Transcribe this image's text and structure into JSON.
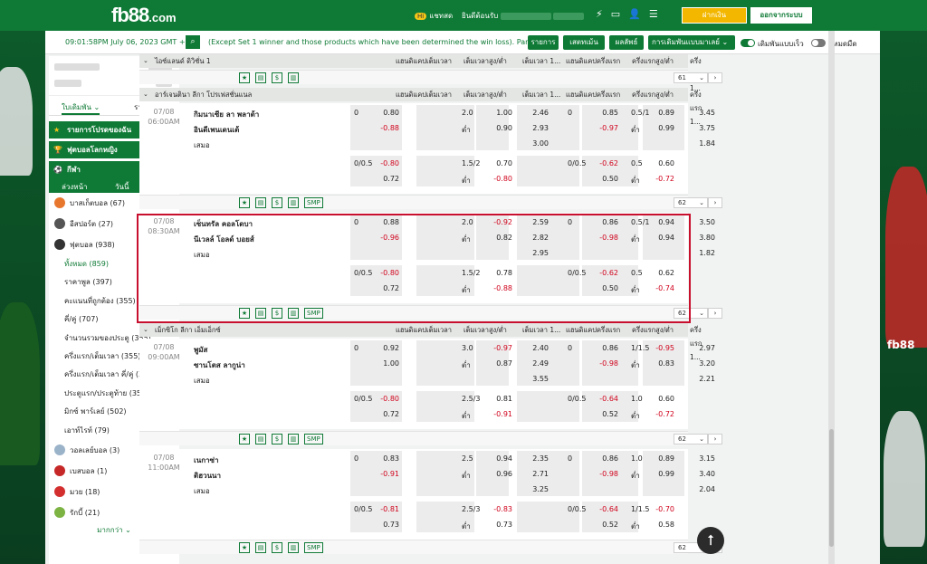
{
  "header": {
    "logo": "fb88",
    "logo_suffix": ".com",
    "chat_badge": "Hi",
    "chat": "แชทสด",
    "welcome": "ยินดีต้อนรับ",
    "deposit": "ฝากเงิน",
    "logout": "ออกจากระบบ",
    "accent": "#0f7a36",
    "gold": "#f3b700"
  },
  "topbar": {
    "clock": "09:01:58PM July 06, 2023 GMT +8",
    "ticker": "(Except Set 1 winner and those products which have been determined the win loss). Parlay",
    "btn_list": "รายการ",
    "btn_bet": "เสตทเม้น",
    "btn_result": "ผลลัพธ์",
    "btn_pending": "การเดิมพันแบบมาเลย์",
    "fast_bet": "เดิมพันแบบเร็ว",
    "dark_mode": "โหมดมืด"
  },
  "leftpanel": {
    "tab_bet": "ใบเดิมพัน",
    "tab_list": "รายการ",
    "g1": "รายการโปรดของฉัน",
    "g2": "ฟุตบอลโลกหญิง",
    "g3": "กีฬา",
    "sub_early": "ล่วงหน้า",
    "sub_today": "วันนี้",
    "sub_live": "สด",
    "live_count": "150",
    "items": [
      {
        "label": "บาสเก็ตบอล (67)",
        "color": "#e8772e"
      },
      {
        "label": "อีสปอร์ต (27)",
        "color": "#555"
      },
      {
        "label": "ฟุตบอล (938)",
        "color": "#333"
      }
    ],
    "football_sub": [
      {
        "label": "ทั้งหมด (859)"
      },
      {
        "label": "ราคาพูล (397)"
      },
      {
        "label": "คะแนนที่ถูกต้อง (355)"
      },
      {
        "label": "คี่/คู่ (707)"
      },
      {
        "label": "จำนวนรวมของประตู (355)"
      },
      {
        "label": "ครึ่งแรก/เต็มเวลา (355)"
      },
      {
        "label": "ครึ่งแรก/เต็มเวลา คี่/คู่ (355)"
      },
      {
        "label": "ประตูแรก/ประตูท้าย (355)"
      },
      {
        "label": "มิกซ์ พาร์เลย์ (502)"
      },
      {
        "label": "เอาท์ไรท์ (79)"
      }
    ],
    "items2": [
      {
        "label": "วอลเลย์บอล (3)",
        "color": "#9bb3c9"
      },
      {
        "label": "เบสบอล (1)",
        "color": "#c62828"
      },
      {
        "label": "มวย (18)",
        "color": "#d32f2f"
      },
      {
        "label": "รักบี้ (21)",
        "color": "#7cb342"
      }
    ],
    "more": "มากกว่า"
  },
  "columns": [
    "แฮนดิแคปเต็มเวลา",
    "เต็มเวลาสูง/ต่ำ",
    "เต็มเวลา 1...",
    "แฮนดิแคปครึ่งแรก",
    "ครึ่งแรกสูง/ต่ำ",
    "ครึ่งแรก 1..."
  ],
  "leagues": [
    {
      "name": "ไอซ์แลนด์ ดิวิชั่น 1",
      "more": "61"
    },
    {
      "name": "อาร์เจนตินา ลีกา โปรเฟสชั่นแนล",
      "more": "62"
    },
    {
      "name": "เม็กซิโก ลีกา เอ็มเอ็กซ์",
      "more": "62"
    }
  ],
  "matches": [
    {
      "date": "07/08",
      "time": "06:00AM",
      "home": "กิมนาเซีย ลา พลาต้า",
      "away": "อินดีเพนเดนเต้",
      "draw": "เสมอ",
      "r1": [
        "0",
        "0.80",
        "2.0",
        "1.00",
        "2.46",
        "0",
        "0.85",
        "0.5/1",
        "0.89",
        "3.45"
      ],
      "r2": [
        "",
        "-0.88",
        "ต่ำ",
        "0.90",
        "2.93",
        "",
        "-0.97",
        "ต่ำ",
        "0.99",
        "3.75"
      ],
      "r3": [
        "3.00",
        "1.84"
      ],
      "a1": [
        "0/0.5",
        "-0.80",
        "1.5/2",
        "0.70",
        "0/0.5",
        "-0.62",
        "0.5",
        "0.60"
      ],
      "a2": [
        "",
        "0.72",
        "ต่ำ",
        "-0.80",
        "",
        "0.50",
        "ต่ำ",
        "-0.72"
      ],
      "more": "62"
    },
    {
      "date": "07/08",
      "time": "08:30AM",
      "home": "เซ็นทรัล คอลโดบา",
      "away": "นีเวลล์ โอลด์ บอยส์",
      "draw": "เสมอ",
      "r1": [
        "0",
        "0.88",
        "2.0",
        "-0.92",
        "2.59",
        "0",
        "0.86",
        "0.5/1",
        "0.94",
        "3.50"
      ],
      "r2": [
        "",
        "-0.96",
        "ต่ำ",
        "0.82",
        "2.82",
        "",
        "-0.98",
        "ต่ำ",
        "0.94",
        "3.80"
      ],
      "r3": [
        "2.95",
        "1.82"
      ],
      "a1": [
        "0/0.5",
        "-0.80",
        "1.5/2",
        "0.78",
        "0/0.5",
        "-0.62",
        "0.5",
        "0.62"
      ],
      "a2": [
        "",
        "0.72",
        "ต่ำ",
        "-0.88",
        "",
        "0.50",
        "ต่ำ",
        "-0.74"
      ],
      "more": "62"
    },
    {
      "date": "07/08",
      "time": "09:00AM",
      "home": "พูมัส",
      "away": "ซานโตส ลากูน่า",
      "draw": "เสมอ",
      "r1": [
        "0",
        "0.92",
        "3.0",
        "-0.97",
        "2.40",
        "0",
        "0.86",
        "1/1.5",
        "-0.95",
        "2.97"
      ],
      "r2": [
        "",
        "1.00",
        "ต่ำ",
        "0.87",
        "2.49",
        "",
        "-0.98",
        "ต่ำ",
        "0.83",
        "3.20"
      ],
      "r3": [
        "3.55",
        "2.21"
      ],
      "a1": [
        "0/0.5",
        "-0.80",
        "2.5/3",
        "0.81",
        "0/0.5",
        "-0.64",
        "1.0",
        "0.60"
      ],
      "a2": [
        "",
        "0.72",
        "ต่ำ",
        "-0.91",
        "",
        "0.52",
        "ต่ำ",
        "-0.72"
      ],
      "more": "62"
    },
    {
      "date": "07/08",
      "time": "11:00AM",
      "home": "เนกาซ่า",
      "away": "ติฮวนนา",
      "draw": "เสมอ",
      "r1": [
        "0",
        "0.83",
        "2.5",
        "0.94",
        "2.35",
        "0",
        "0.86",
        "1.0",
        "0.89",
        "3.15"
      ],
      "r2": [
        "",
        "-0.91",
        "ต่ำ",
        "0.96",
        "2.71",
        "",
        "-0.98",
        "ต่ำ",
        "0.99",
        "3.40"
      ],
      "r3": [
        "3.25",
        "2.04"
      ],
      "a1": [
        "0/0.5",
        "-0.81",
        "2.5/3",
        "-0.83",
        "0/0.5",
        "-0.64",
        "1/1.5",
        "-0.70"
      ],
      "a2": [
        "",
        "0.73",
        "ต่ำ",
        "0.73",
        "",
        "0.52",
        "ต่ำ",
        "0.58"
      ],
      "more": "62"
    }
  ],
  "footer": {
    "smp": "SMP",
    "next": "›"
  },
  "side": {
    "brand": "fb88"
  }
}
